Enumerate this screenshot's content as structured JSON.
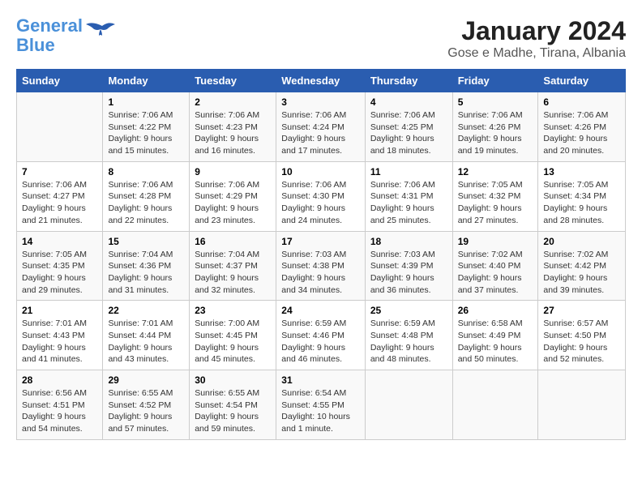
{
  "logo": {
    "line1": "General",
    "line2": "Blue"
  },
  "title": "January 2024",
  "subtitle": "Gose e Madhe, Tirana, Albania",
  "days_of_week": [
    "Sunday",
    "Monday",
    "Tuesday",
    "Wednesday",
    "Thursday",
    "Friday",
    "Saturday"
  ],
  "weeks": [
    [
      {
        "day": "",
        "sunrise": "",
        "sunset": "",
        "daylight": ""
      },
      {
        "day": "1",
        "sunrise": "Sunrise: 7:06 AM",
        "sunset": "Sunset: 4:22 PM",
        "daylight": "Daylight: 9 hours and 15 minutes."
      },
      {
        "day": "2",
        "sunrise": "Sunrise: 7:06 AM",
        "sunset": "Sunset: 4:23 PM",
        "daylight": "Daylight: 9 hours and 16 minutes."
      },
      {
        "day": "3",
        "sunrise": "Sunrise: 7:06 AM",
        "sunset": "Sunset: 4:24 PM",
        "daylight": "Daylight: 9 hours and 17 minutes."
      },
      {
        "day": "4",
        "sunrise": "Sunrise: 7:06 AM",
        "sunset": "Sunset: 4:25 PM",
        "daylight": "Daylight: 9 hours and 18 minutes."
      },
      {
        "day": "5",
        "sunrise": "Sunrise: 7:06 AM",
        "sunset": "Sunset: 4:26 PM",
        "daylight": "Daylight: 9 hours and 19 minutes."
      },
      {
        "day": "6",
        "sunrise": "Sunrise: 7:06 AM",
        "sunset": "Sunset: 4:26 PM",
        "daylight": "Daylight: 9 hours and 20 minutes."
      }
    ],
    [
      {
        "day": "7",
        "sunrise": "Sunrise: 7:06 AM",
        "sunset": "Sunset: 4:27 PM",
        "daylight": "Daylight: 9 hours and 21 minutes."
      },
      {
        "day": "8",
        "sunrise": "Sunrise: 7:06 AM",
        "sunset": "Sunset: 4:28 PM",
        "daylight": "Daylight: 9 hours and 22 minutes."
      },
      {
        "day": "9",
        "sunrise": "Sunrise: 7:06 AM",
        "sunset": "Sunset: 4:29 PM",
        "daylight": "Daylight: 9 hours and 23 minutes."
      },
      {
        "day": "10",
        "sunrise": "Sunrise: 7:06 AM",
        "sunset": "Sunset: 4:30 PM",
        "daylight": "Daylight: 9 hours and 24 minutes."
      },
      {
        "day": "11",
        "sunrise": "Sunrise: 7:06 AM",
        "sunset": "Sunset: 4:31 PM",
        "daylight": "Daylight: 9 hours and 25 minutes."
      },
      {
        "day": "12",
        "sunrise": "Sunrise: 7:05 AM",
        "sunset": "Sunset: 4:32 PM",
        "daylight": "Daylight: 9 hours and 27 minutes."
      },
      {
        "day": "13",
        "sunrise": "Sunrise: 7:05 AM",
        "sunset": "Sunset: 4:34 PM",
        "daylight": "Daylight: 9 hours and 28 minutes."
      }
    ],
    [
      {
        "day": "14",
        "sunrise": "Sunrise: 7:05 AM",
        "sunset": "Sunset: 4:35 PM",
        "daylight": "Daylight: 9 hours and 29 minutes."
      },
      {
        "day": "15",
        "sunrise": "Sunrise: 7:04 AM",
        "sunset": "Sunset: 4:36 PM",
        "daylight": "Daylight: 9 hours and 31 minutes."
      },
      {
        "day": "16",
        "sunrise": "Sunrise: 7:04 AM",
        "sunset": "Sunset: 4:37 PM",
        "daylight": "Daylight: 9 hours and 32 minutes."
      },
      {
        "day": "17",
        "sunrise": "Sunrise: 7:03 AM",
        "sunset": "Sunset: 4:38 PM",
        "daylight": "Daylight: 9 hours and 34 minutes."
      },
      {
        "day": "18",
        "sunrise": "Sunrise: 7:03 AM",
        "sunset": "Sunset: 4:39 PM",
        "daylight": "Daylight: 9 hours and 36 minutes."
      },
      {
        "day": "19",
        "sunrise": "Sunrise: 7:02 AM",
        "sunset": "Sunset: 4:40 PM",
        "daylight": "Daylight: 9 hours and 37 minutes."
      },
      {
        "day": "20",
        "sunrise": "Sunrise: 7:02 AM",
        "sunset": "Sunset: 4:42 PM",
        "daylight": "Daylight: 9 hours and 39 minutes."
      }
    ],
    [
      {
        "day": "21",
        "sunrise": "Sunrise: 7:01 AM",
        "sunset": "Sunset: 4:43 PM",
        "daylight": "Daylight: 9 hours and 41 minutes."
      },
      {
        "day": "22",
        "sunrise": "Sunrise: 7:01 AM",
        "sunset": "Sunset: 4:44 PM",
        "daylight": "Daylight: 9 hours and 43 minutes."
      },
      {
        "day": "23",
        "sunrise": "Sunrise: 7:00 AM",
        "sunset": "Sunset: 4:45 PM",
        "daylight": "Daylight: 9 hours and 45 minutes."
      },
      {
        "day": "24",
        "sunrise": "Sunrise: 6:59 AM",
        "sunset": "Sunset: 4:46 PM",
        "daylight": "Daylight: 9 hours and 46 minutes."
      },
      {
        "day": "25",
        "sunrise": "Sunrise: 6:59 AM",
        "sunset": "Sunset: 4:48 PM",
        "daylight": "Daylight: 9 hours and 48 minutes."
      },
      {
        "day": "26",
        "sunrise": "Sunrise: 6:58 AM",
        "sunset": "Sunset: 4:49 PM",
        "daylight": "Daylight: 9 hours and 50 minutes."
      },
      {
        "day": "27",
        "sunrise": "Sunrise: 6:57 AM",
        "sunset": "Sunset: 4:50 PM",
        "daylight": "Daylight: 9 hours and 52 minutes."
      }
    ],
    [
      {
        "day": "28",
        "sunrise": "Sunrise: 6:56 AM",
        "sunset": "Sunset: 4:51 PM",
        "daylight": "Daylight: 9 hours and 54 minutes."
      },
      {
        "day": "29",
        "sunrise": "Sunrise: 6:55 AM",
        "sunset": "Sunset: 4:52 PM",
        "daylight": "Daylight: 9 hours and 57 minutes."
      },
      {
        "day": "30",
        "sunrise": "Sunrise: 6:55 AM",
        "sunset": "Sunset: 4:54 PM",
        "daylight": "Daylight: 9 hours and 59 minutes."
      },
      {
        "day": "31",
        "sunrise": "Sunrise: 6:54 AM",
        "sunset": "Sunset: 4:55 PM",
        "daylight": "Daylight: 10 hours and 1 minute."
      },
      {
        "day": "",
        "sunrise": "",
        "sunset": "",
        "daylight": ""
      },
      {
        "day": "",
        "sunrise": "",
        "sunset": "",
        "daylight": ""
      },
      {
        "day": "",
        "sunrise": "",
        "sunset": "",
        "daylight": ""
      }
    ]
  ]
}
